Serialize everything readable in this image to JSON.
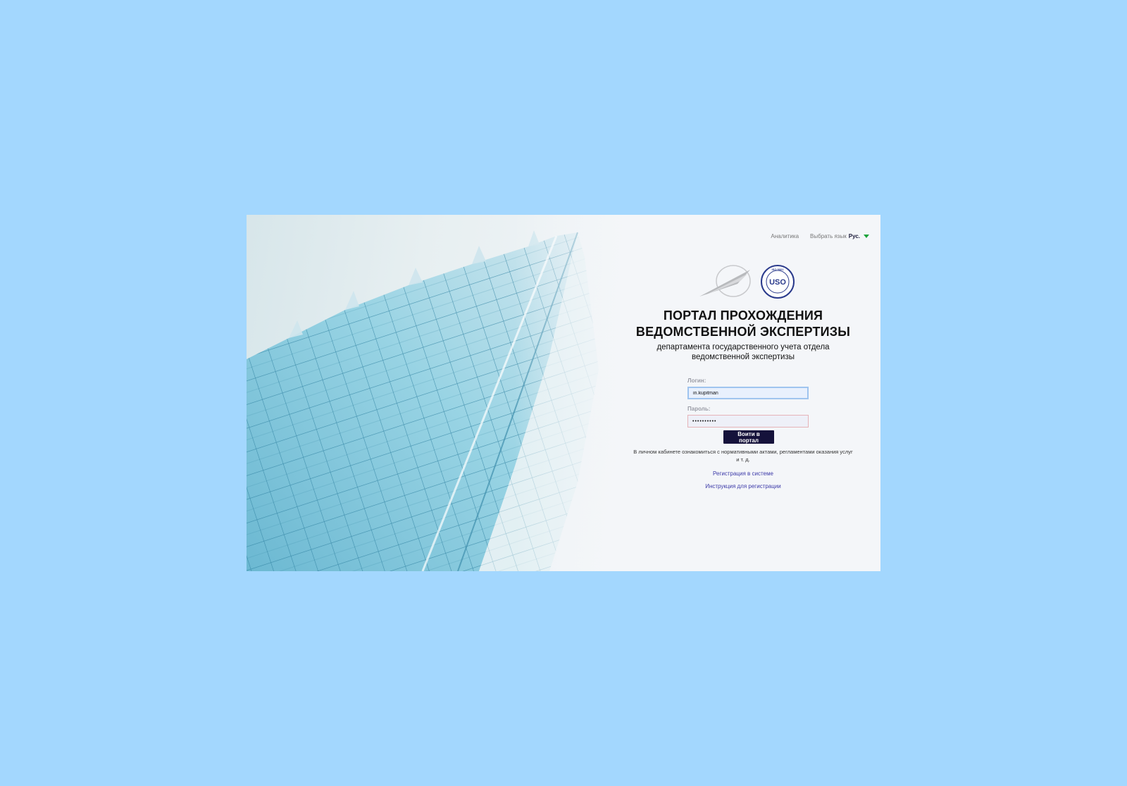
{
  "nav": {
    "analytics": "Аналитика",
    "lang_label": "Выбрать язык",
    "lang_current": "Рус."
  },
  "logos": {
    "seal_text": "USO",
    "seal_ring_text": "ISO 9001"
  },
  "title": {
    "line1": "ПОРТАЛ ПРОХОЖДЕНИЯ",
    "line2": "ВЕДОМСТВЕННОЙ ЭКСПЕРТИЗЫ"
  },
  "subtitle": {
    "line1": "департамента государственного учета отдела",
    "line2": "ведомственной экспертизы"
  },
  "form": {
    "login_label": "Логин:",
    "login_value": "in.kupitman",
    "password_label": "Пароль:",
    "password_value": "••••••••••",
    "submit_label": "Воити в портал"
  },
  "info": {
    "line1": "В личном кабинете ознакомиться с нормативными актами, регламентами оказания услуг",
    "line2": "и т. д."
  },
  "links": {
    "register": "Регистрация в системе",
    "instructions": "Инструкция для регистрации"
  },
  "colors": {
    "background": "#a3d7fe",
    "button": "#15123b",
    "link": "#3c3aa8",
    "caret": "#1aa33a"
  }
}
